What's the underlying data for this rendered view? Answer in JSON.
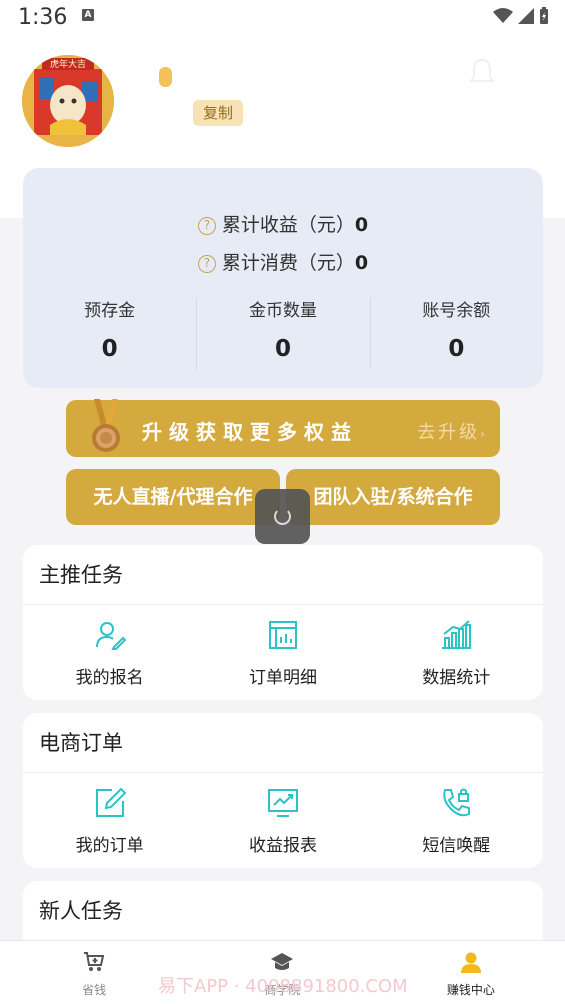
{
  "status_bar": {
    "time": "1:36",
    "a_icon": "A"
  },
  "profile": {
    "avatar_banner_text": "虎年大吉",
    "copy_label": "复制"
  },
  "stats": {
    "cumulative_income_label": "累计收益（元）",
    "cumulative_income_value": "0",
    "cumulative_spend_label": "累计消费（元）",
    "cumulative_spend_value": "0",
    "question_glyph": "?",
    "columns": [
      {
        "label": "预存金",
        "value": "0"
      },
      {
        "label": "金币数量",
        "value": "0"
      },
      {
        "label": "账号余额",
        "value": "0"
      }
    ]
  },
  "upgrade": {
    "title": "升级获取更多权益",
    "go_label": "去升级",
    "chevron": "›"
  },
  "actions": {
    "left_label": "无人直播/代理合作",
    "right_label": "团队入驻/系统合作"
  },
  "sections": [
    {
      "title": "主推任务",
      "items": [
        {
          "label": "我的报名",
          "icon": "person-edit-icon"
        },
        {
          "label": "订单明细",
          "icon": "report-icon"
        },
        {
          "label": "数据统计",
          "icon": "bar-chart-icon"
        }
      ]
    },
    {
      "title": "电商订单",
      "items": [
        {
          "label": "我的订单",
          "icon": "edit-square-icon"
        },
        {
          "label": "收益报表",
          "icon": "trend-monitor-icon"
        },
        {
          "label": "短信唤醒",
          "icon": "phone-lock-icon"
        }
      ]
    },
    {
      "title": "新人任务"
    }
  ],
  "bottom_nav": [
    {
      "label": "省钱",
      "icon": "cart-icon"
    },
    {
      "label": "商学院",
      "icon": "graduation-cap-icon"
    },
    {
      "label": "赚钱中心",
      "icon": "user-icon",
      "active": true
    }
  ],
  "watermark": "易下APP · 4008891800.COM",
  "colors": {
    "accent_gold": "#d4a93e",
    "teal_icon": "#2bc3c3",
    "card_bg": "#e6ebf6"
  }
}
